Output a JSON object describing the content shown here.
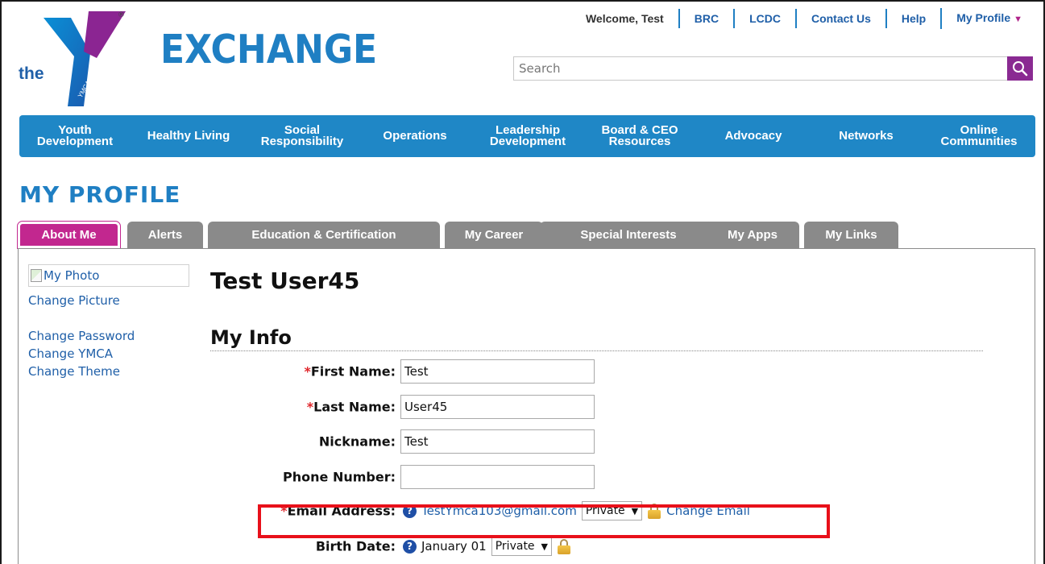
{
  "logo": {
    "the_text": "the",
    "tm": "®",
    "exchange_text": "EXCHANGE",
    "ymca_small": "YMCA"
  },
  "header": {
    "welcome": "Welcome, Test",
    "links": [
      "BRC",
      "LCDC",
      "Contact Us",
      "Help",
      "My Profile"
    ],
    "profile_caret": "▼"
  },
  "search": {
    "placeholder": "Search"
  },
  "nav": [
    "Youth\nDevelopment",
    "Healthy Living",
    "Social\nResponsibility",
    "Operations",
    "Leadership\nDevelopment",
    "Board & CEO\nResources",
    "Advocacy",
    "Networks",
    "Online\nCommunities"
  ],
  "page_title": "MY PROFILE",
  "tabs": [
    "About Me",
    "Alerts",
    "Education & Certification",
    "My Career",
    "Special Interests",
    "My Apps",
    "My Links"
  ],
  "sidebar": {
    "photo_alt": "My Photo",
    "change_picture": "Change Picture",
    "change_password": "Change Password",
    "change_ymca": "Change YMCA",
    "change_theme": "Change Theme"
  },
  "user_name": "Test User45",
  "section_title": "My Info",
  "form": {
    "required_mark": "*",
    "first_name_label": "First Name",
    "first_name_value": "Test",
    "last_name_label": "Last Name",
    "last_name_value": "User45",
    "nickname_label": "Nickname",
    "nickname_value": "Test",
    "phone_label": "Phone Number",
    "phone_value": "",
    "email_label": "Email Address",
    "email_value": "TestYmca103@gmail.com",
    "email_privacy": "Private",
    "change_email": "Change Email",
    "birth_label": "Birth Date",
    "birth_value": "January 01",
    "birth_privacy": "Private",
    "colon": ":"
  },
  "colors": {
    "brand_blue": "#1f87c6",
    "brand_purple": "#8a2a92",
    "active_tab": "#c2278f",
    "highlight": "#e8101a"
  }
}
